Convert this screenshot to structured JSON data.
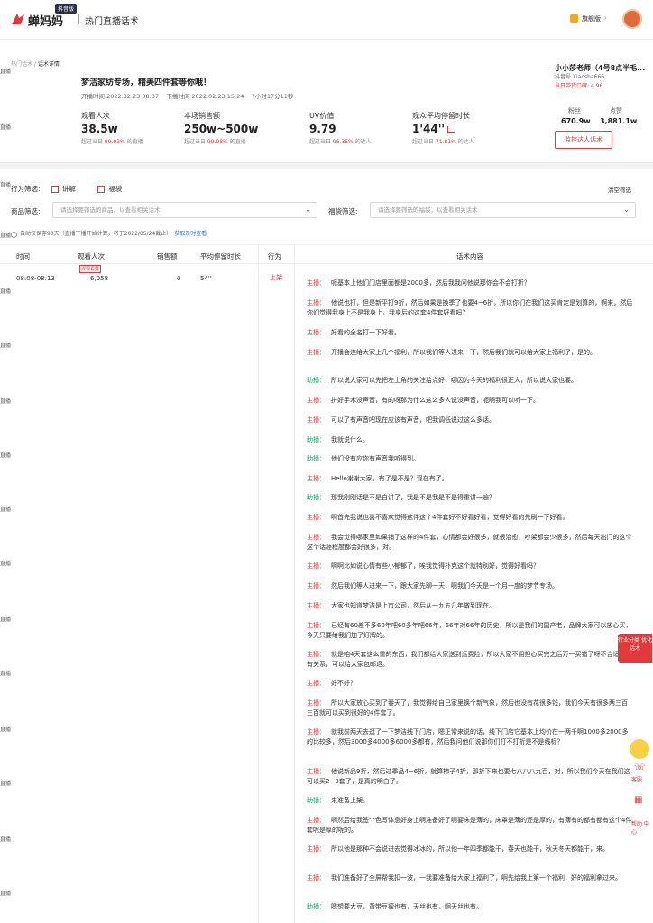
{
  "header": {
    "brand": "蝉妈妈",
    "badge": "抖音版",
    "section": "热门直播话术",
    "plan": "旗舰版",
    "plan_caret": "›",
    "brand_color": "#e4393c"
  },
  "side_tag": "直播",
  "breadcrumb": {
    "parent": "热门话术",
    "sep": " / ",
    "current": "话术详情"
  },
  "live": {
    "title": "梦洁家纺专场，精美四件套等你哦！",
    "start": "开播时间  2022.02.23 08:07",
    "end": "下播时间  2022.02.23 15:24",
    "duration": "7小时17分11秒"
  },
  "stats": [
    {
      "label": "观看人次",
      "value": "38.5w",
      "cmp_prefix": "超过当日 ",
      "cmp_pct": "99.93%",
      "cmp_suffix": " 的直播"
    },
    {
      "label": "本场销售额",
      "value": "250w~500w",
      "cmp_prefix": "超过当日 ",
      "cmp_pct": "99.98%",
      "cmp_suffix": " 的直播"
    },
    {
      "label": "UV价值",
      "value": "9.79",
      "cmp_prefix": "超过当日 ",
      "cmp_pct": "96.35%",
      "cmp_suffix": " 的达人"
    },
    {
      "label": "观众平均停留时长",
      "value": "1'44''",
      "cmp_prefix": "超过当日 ",
      "cmp_pct": "71.81%",
      "cmp_suffix": " 的达人"
    }
  ],
  "anchor": {
    "name": "小小莎老师（4号8点半毛...",
    "id": "抖音号 Xiaosha666",
    "reputation": "当日带货口碑: 4.96",
    "fans_label": "粉丝",
    "fans": "670.9w",
    "likes_label": "点赞",
    "likes": "3,881.1w",
    "monitor_btn": "监控达人话术"
  },
  "filters": {
    "behavior_label": "行为筛选:",
    "opt1": "讲解",
    "opt2": "福袋",
    "clear": "清空筛选",
    "product_label": "商品筛选:",
    "product_ph": "请选择要筛选的商品，以查看相关话术",
    "bag_label": "福袋筛选:",
    "bag_ph": "请选择要筛选的福袋，以查看相关话术",
    "caret": "⌄",
    "note_icon": "i",
    "note": "自动仅保存90天（直播下播开始计算，将于2022/05/24截止），",
    "note_link": "获取及时查看"
  },
  "table": {
    "headers": [
      "时间",
      "观看人次",
      "销售额",
      "平均停留时长",
      "行为",
      "话术内容"
    ],
    "peak_tag": "点观看量",
    "row": {
      "time": "08:08-08:13",
      "viewers": "6,058",
      "sales": "0",
      "stay": "54''",
      "action": "上架"
    }
  },
  "host_label": "主播：",
  "asst_label": "助播：",
  "lines": [
    {
      "s": "host",
      "t": "呃基本上他们门店里面都是2000多，然后我我问他说那你会不会打折？"
    },
    {
      "s": "host",
      "t": "他说也打，但是新平打9折，然后如果是换季了也要4~6折，所以你们在我们这买肯定是划算的，啊来，然后你们觉得我身上不是我身上，我身后的这套4件套好看吗？"
    },
    {
      "s": "host",
      "t": "好看的全名打一下好看。"
    },
    {
      "s": "host",
      "t": "开播会连给大家上几个福利，所以我们等人进来一下，然后我们就可以给大家上福利了，是的。"
    },
    {
      "s": "asst",
      "t": "所以说大家可以先把左上角的关注给点好，哪因为今天的福利很正大，所以说大家也要。"
    },
    {
      "s": "host",
      "t": "拼好手术没声音，有的呀那为什么这么多人说没声音，呃啊我可以听一下。"
    },
    {
      "s": "host",
      "t": "可以了有声音吧现在应该有声音，吧我调低说过这么多话。"
    },
    {
      "s": "asst",
      "t": "我就说什么。"
    },
    {
      "s": "asst",
      "t": "他们没有应你有声音我听得到。"
    },
    {
      "s": "host",
      "t": "Hello谢谢大家，有了是不是？现在有了。"
    },
    {
      "s": "asst",
      "t": "那我刚刚话是不是白讲了，我是不是我是不是得重讲一遍？"
    },
    {
      "s": "host",
      "t": "啊首先我说也喜不喜欢觉得这件这个4件套好不好看好看，觉得好看的先刷一下好看。"
    },
    {
      "s": "host",
      "t": "我会觉得哪家里如果铺了这样的4件套，心情都会好很多，就很治愈，吵架都会少很多，然后每天出门的这个这个话涯程度都会好很多，对。"
    },
    {
      "s": "host",
      "t": "啊啊比如说心情有些小郁郁了，唉我觉得扑克这个就特别好，觉得好看吗？"
    },
    {
      "s": "host",
      "t": "然后我们等人进来一下，跟大家先聊一天，啊我们今天是一个月一度的梦节专场。"
    },
    {
      "s": "host",
      "t": "大家也知道梦洁是上市公司，然后从一九五几年做到现在。"
    },
    {
      "s": "host",
      "t": "已经有60差不多60年吧60多年吧66年，66年对66年的历史，所以是我们的国产老，品牌大家可以放心买，今天只要给我们加了灯牌的。"
    },
    {
      "s": "host",
      "t": "就是咱4天套这么重的东西，我们都给大家送到运费险，所以大家不用担心买完之后万一买错了呀不合适，没有关系，可以给大家包邮退。"
    },
    {
      "s": "host",
      "t": "好不好？"
    },
    {
      "s": "host",
      "t": "所以大家放心买到了春天了，我觉得给自己家里换个新气象，然后也没有花很多钱，我们今天有很多两三百三百就可以买到很好的4件套了。"
    },
    {
      "s": "host",
      "t": "就我前两天去逛了一下梦洁线下门店，嗯正常来说的话，线下门店它基本上均价在一两千啊1000多2000多的比较多，然后3000多4000多6000多都有，然后我问他们说那你们打不打折是不是线标？"
    },
    {
      "s": "host",
      "t": "他说新品9折，然后过季品4~6折，就算柿子4折，那折下来也要七八八八九百，对，所以我们今天在我们这可以买2~3套了，是真的明白了。"
    },
    {
      "s": "asst",
      "t": "来准备上架。"
    },
    {
      "s": "host",
      "t": "啊然后给我签个色写体息好身上啊准备好了啊要床是薄的，床罩是薄的还是厚的，有薄有的都有都有这个4件套呢是厚的呢的。"
    },
    {
      "s": "host",
      "t": "所以他是那种不会说进去觉得冰冰的，所以他一年四季都能干，春天也能干，秋天冬天都能干，来。"
    },
    {
      "s": "host",
      "t": "我们准备好了全屏帮我扣一波，一我要准备给大家上福利了，啊先给我上第一个福利，好的福利拿过来。"
    },
    {
      "s": "asst",
      "t": "嗯想要大豆，背带豆瘤也有，天丝也有，啊天丝也有。"
    }
  ],
  "float": {
    "card": "行业分类 优化话术",
    "service": "客服",
    "help": "帮助 中心"
  }
}
